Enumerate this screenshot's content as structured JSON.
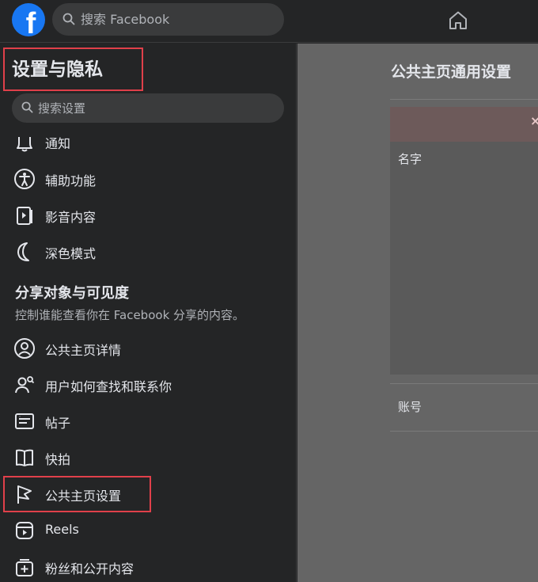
{
  "topbar": {
    "logo_letter": "f",
    "search_placeholder": "搜索 Facebook"
  },
  "sidebar": {
    "title": "设置与隐私",
    "search_placeholder": "搜索设置",
    "items_top": [
      {
        "label": "通知",
        "icon": "bell-icon"
      },
      {
        "label": "辅助功能",
        "icon": "accessibility-icon"
      },
      {
        "label": "影音内容",
        "icon": "media-icon"
      },
      {
        "label": "深色模式",
        "icon": "moon-icon"
      }
    ],
    "section": {
      "title": "分享对象与可见度",
      "description": "控制谁能查看你在 Facebook 分享的内容。"
    },
    "items_section": [
      {
        "label": "公共主页详情",
        "icon": "profile-icon"
      },
      {
        "label": "用户如何查找和联系你",
        "icon": "find-people-icon"
      },
      {
        "label": "帖子",
        "icon": "posts-icon"
      },
      {
        "label": "快拍",
        "icon": "stories-icon"
      },
      {
        "label": "公共主页设置",
        "icon": "flag-icon"
      },
      {
        "label": "Reels",
        "icon": "reels-icon"
      },
      {
        "label": "粉丝和公开内容",
        "icon": "followers-icon"
      }
    ]
  },
  "main": {
    "title": "公共主页通用设置",
    "banner_close": "×",
    "fields": {
      "name_label": "名字",
      "account_label": "账号"
    }
  },
  "colors": {
    "accent": "#1877f2",
    "highlight_box": "#e0404a",
    "sidebar_bg": "#242526",
    "main_bg": "#656565"
  }
}
